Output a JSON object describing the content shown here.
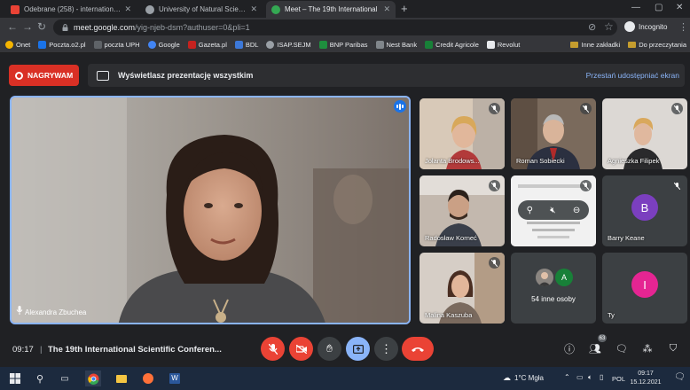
{
  "browser": {
    "tabs": [
      {
        "label": "Odebrane (258) - international.o",
        "icon_color": "#ea4335",
        "active": false
      },
      {
        "label": "University of Natural Sciences an",
        "icon_color": "#9aa0a6",
        "active": false
      },
      {
        "label": "Meet – The 19th International",
        "icon_color": "#34a853",
        "active": true
      }
    ],
    "new_tab": "+",
    "url_host": "meet.google.com",
    "url_path": "/yig-njeb-dsm?authuser=0&pli=1",
    "profile_label": "Incognito",
    "bookmarks": [
      {
        "label": "Onet",
        "color": "#f4b400"
      },
      {
        "label": "Poczta.o2.pl",
        "color": "#1a73e8"
      },
      {
        "label": "poczta UPH",
        "color": "#5f6368"
      },
      {
        "label": "Google",
        "color": "#4285f4"
      },
      {
        "label": "Gazeta.pl",
        "color": "#c5221f"
      },
      {
        "label": "BDL",
        "color": "#3c78d8"
      },
      {
        "label": "ISAP.SEJM",
        "color": "#9aa0a6"
      },
      {
        "label": "BNP Paribas",
        "color": "#1e8e3e"
      },
      {
        "label": "Nest Bank",
        "color": "#80868b"
      },
      {
        "label": "Credit Agricole",
        "color": "#188038"
      },
      {
        "label": "Revolut",
        "color": "#e8eaed"
      }
    ],
    "bookmark_folders": [
      "Inne zakładki",
      "Do przeczytania"
    ]
  },
  "meet": {
    "recording_label": "NAGRYWAM",
    "presentation_text": "Wyświetlasz prezentację wszystkim",
    "stop_sharing_label": "Przestań udostępniać ekran",
    "main_speaker": "Alexandra Zbuchea",
    "tiles": [
      {
        "name": "Jolanta Brodows...",
        "type": "video",
        "bg": "#c9b9a8"
      },
      {
        "name": "Roman Sobiecki",
        "type": "video",
        "bg": "#8b7a6a"
      },
      {
        "name": "Agnieszka Filipek",
        "type": "video",
        "bg": "#d9d4cf"
      },
      {
        "name": "Radosław Korneć",
        "type": "video",
        "bg": "#b9aea4"
      },
      {
        "name": "",
        "type": "presentation",
        "bg": "#e8e8e8"
      },
      {
        "name": "Barry Keane",
        "type": "avatar",
        "initial": "B",
        "avatar_color": "#7b3fbf"
      },
      {
        "name": "Malina Kaszuba",
        "type": "video",
        "bg": "#c8beb6"
      },
      {
        "name": "54 inne osoby",
        "type": "others",
        "initial": "A",
        "avatar_color": "#188038"
      },
      {
        "name": "Ty",
        "type": "avatar",
        "initial": "I",
        "avatar_color": "#e52592"
      }
    ],
    "time": "09:17",
    "separator": "|",
    "conference_title": "The 19th International Scientific Conferen...",
    "participant_count": "63"
  },
  "taskbar": {
    "weather": "1°C  Mgła",
    "language": "POL",
    "clock_time": "09:17",
    "clock_date": "15.12.2021"
  }
}
